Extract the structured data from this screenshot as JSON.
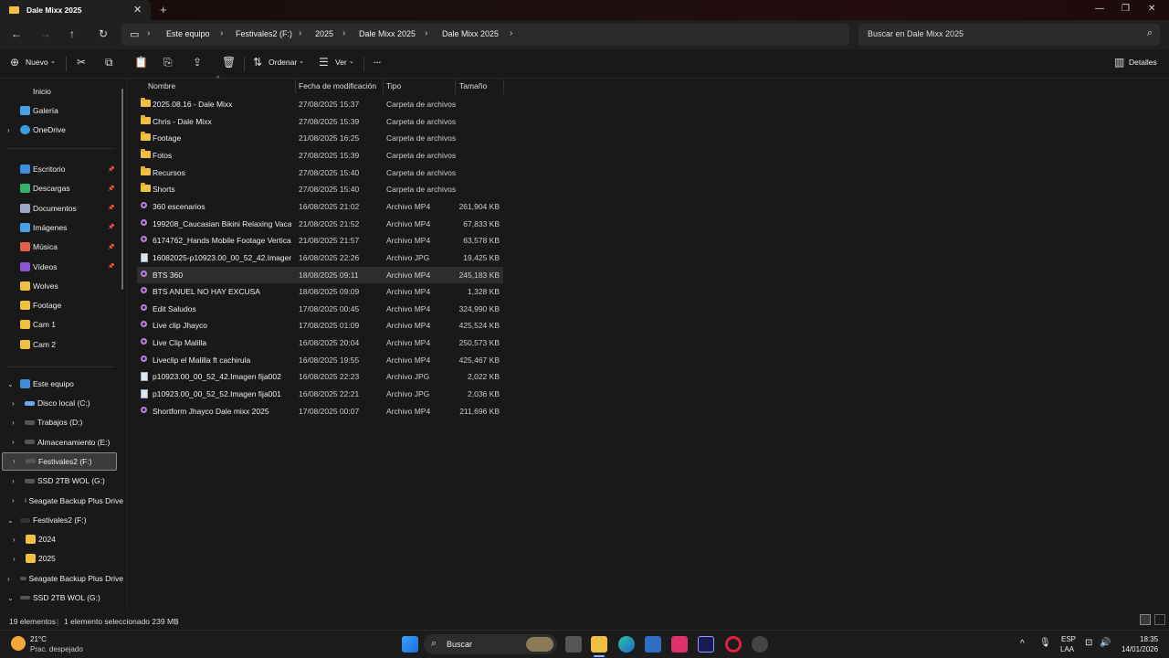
{
  "window": {
    "tab_title": "Dale Mixx 2025",
    "new_tab": "+",
    "close_tab": "✕"
  },
  "address": {
    "breadcrumbs": [
      "Este equipo",
      "Festivales2 (F:)",
      "2025",
      "Dale Mixx 2025",
      "Dale Mixx 2025"
    ],
    "search_placeholder": "Buscar en Dale Mixx 2025"
  },
  "toolbar": {
    "new_label": "Nuevo",
    "sort_label": "Ordenar",
    "view_label": "Ver",
    "more_label": "···",
    "details_label": "Detalles"
  },
  "sidebar": {
    "quick": [
      {
        "label": "Inicio"
      },
      {
        "label": "Galería"
      },
      {
        "label": "OneDrive"
      }
    ],
    "pinned": [
      {
        "label": "Escritorio",
        "color": "#3d8fe0"
      },
      {
        "label": "Descargas",
        "color": "#2fb36b"
      },
      {
        "label": "Documentos",
        "color": "#9aaac8"
      },
      {
        "label": "Imágenes",
        "color": "#4aa0e8"
      },
      {
        "label": "Música",
        "color": "#e0604a"
      },
      {
        "label": "Vídeos",
        "color": "#8d55d8"
      },
      {
        "label": "Wolves",
        "color": "#f0c040"
      },
      {
        "label": "Footage",
        "color": "#f0c040"
      },
      {
        "label": "Cam 1",
        "color": "#f0c040"
      },
      {
        "label": "Cam 2",
        "color": "#f0c040"
      }
    ],
    "this_pc": "Este equipo",
    "drives": [
      {
        "label": "Disco local (C:)"
      },
      {
        "label": "Trabajos (D:)"
      },
      {
        "label": "Almacenamiento  (E:)"
      },
      {
        "label": "Festivales2 (F:)"
      },
      {
        "label": "SSD 2TB WOL (G:)"
      },
      {
        "label": "Seagate Backup Plus Drive"
      }
    ],
    "festivales": "Festivales2 (F:)",
    "fest_children": [
      {
        "label": "2024"
      },
      {
        "label": "2025"
      }
    ],
    "seagate": "Seagate Backup Plus Drive",
    "ssd": "SSD 2TB WOL (G:)"
  },
  "columns": {
    "name": "Nombre",
    "date": "Fecha de modificación",
    "type": "Tipo",
    "size": "Tamaño"
  },
  "files": [
    {
      "name": "2025.08.16 - Dale Mixx",
      "date": "27/08/2025 15:37",
      "type": "Carpeta de archivos",
      "size": "",
      "kind": "folder"
    },
    {
      "name": "Chris - Dale Mixx",
      "date": "27/08/2025 15:39",
      "type": "Carpeta de archivos",
      "size": "",
      "kind": "folder"
    },
    {
      "name": "Footage",
      "date": "21/08/2025 16:25",
      "type": "Carpeta de archivos",
      "size": "",
      "kind": "folder"
    },
    {
      "name": "Fotos",
      "date": "27/08/2025 15:39",
      "type": "Carpeta de archivos",
      "size": "",
      "kind": "folder"
    },
    {
      "name": "Recursos",
      "date": "27/08/2025 15:40",
      "type": "Carpeta de archivos",
      "size": "",
      "kind": "folder"
    },
    {
      "name": "Shorts",
      "date": "27/08/2025 15:40",
      "type": "Carpeta de archivos",
      "size": "",
      "kind": "folder"
    },
    {
      "name": "360 escenarios",
      "date": "16/08/2025 21:02",
      "type": "Archivo MP4",
      "size": "261,904 KB",
      "kind": "mp4"
    },
    {
      "name": "199208_Caucasian Bikini Relaxing Vacatio...",
      "date": "21/08/2025 21:52",
      "type": "Archivo MP4",
      "size": "67,833 KB",
      "kind": "mp4"
    },
    {
      "name": "6174762_Hands Mobile Footage Vertical F...",
      "date": "21/08/2025 21:57",
      "type": "Archivo MP4",
      "size": "63,578 KB",
      "kind": "mp4"
    },
    {
      "name": "16082025-p10923.00_00_52_42.Imagen fij...",
      "date": "16/08/2025 22:26",
      "type": "Archivo JPG",
      "size": "19,425 KB",
      "kind": "jpg"
    },
    {
      "name": "BTS 360",
      "date": "18/08/2025 09:11",
      "type": "Archivo MP4",
      "size": "245,183 KB",
      "kind": "mp4",
      "selected": true
    },
    {
      "name": "BTS ANUEL NO HAY EXCUSA",
      "date": "18/08/2025 09:09",
      "type": "Archivo MP4",
      "size": "1,328 KB",
      "kind": "mp4"
    },
    {
      "name": "Edit Saludos",
      "date": "17/08/2025 00:45",
      "type": "Archivo MP4",
      "size": "324,990 KB",
      "kind": "mp4"
    },
    {
      "name": "Live clip Jhayco",
      "date": "17/08/2025 01:09",
      "type": "Archivo MP4",
      "size": "425,524 KB",
      "kind": "mp4"
    },
    {
      "name": "Live Clip Malilla",
      "date": "16/08/2025 20:04",
      "type": "Archivo MP4",
      "size": "250,573 KB",
      "kind": "mp4"
    },
    {
      "name": "Liveclip el Malilla ft cachirula",
      "date": "16/08/2025 19:55",
      "type": "Archivo MP4",
      "size": "425,467 KB",
      "kind": "mp4"
    },
    {
      "name": "p10923.00_00_52_42.Imagen fija002",
      "date": "16/08/2025 22:23",
      "type": "Archivo JPG",
      "size": "2,022 KB",
      "kind": "jpg"
    },
    {
      "name": "p10923.00_00_52_52.Imagen fija001",
      "date": "16/08/2025 22:21",
      "type": "Archivo JPG",
      "size": "2,036 KB",
      "kind": "jpg"
    },
    {
      "name": "Shortform Jhayco Dale mixx 2025",
      "date": "17/08/2025 00:07",
      "type": "Archivo MP4",
      "size": "211,696 KB",
      "kind": "mp4"
    }
  ],
  "status": {
    "count": "19 elementos",
    "selection": "1 elemento seleccionado  239 MB"
  },
  "taskbar": {
    "weather_temp": "21°C",
    "weather_desc": "Prac. despejado",
    "search_label": "Buscar",
    "lang_top": "ESP",
    "lang_bottom": "LAA",
    "time": "18:35",
    "date": "14/01/2026"
  }
}
